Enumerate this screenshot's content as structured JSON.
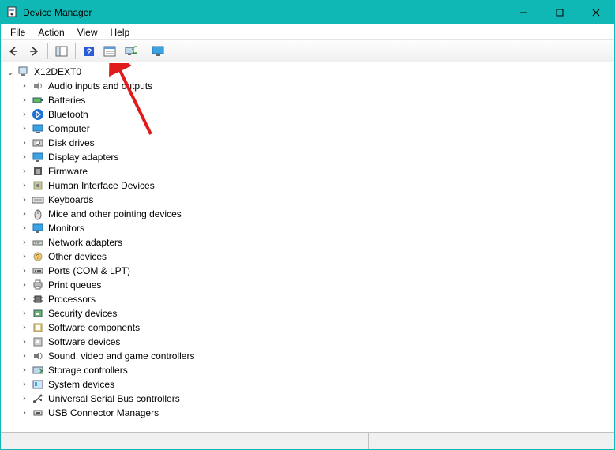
{
  "window": {
    "title": "Device Manager"
  },
  "menubar": {
    "items": [
      "File",
      "Action",
      "View",
      "Help"
    ]
  },
  "toolbar": {
    "buttons": [
      {
        "name": "back-button",
        "icon": "arrow-left-icon"
      },
      {
        "name": "forward-button",
        "icon": "arrow-right-icon"
      },
      {
        "name": "show-hide-console-button",
        "icon": "console-tree-icon"
      },
      {
        "name": "help-button",
        "icon": "help-icon"
      },
      {
        "name": "properties-button",
        "icon": "properties-icon"
      },
      {
        "name": "scan-hardware-button",
        "icon": "scan-hardware-icon"
      },
      {
        "name": "add-legacy-hardware-button",
        "icon": "monitor-icon"
      }
    ]
  },
  "tree": {
    "root": {
      "label": "X12DEXT0",
      "icon": "computer-root-icon",
      "expanded": true
    },
    "children": [
      {
        "label": "Audio inputs and outputs",
        "icon": "audio-icon"
      },
      {
        "label": "Batteries",
        "icon": "battery-icon"
      },
      {
        "label": "Bluetooth",
        "icon": "bluetooth-icon"
      },
      {
        "label": "Computer",
        "icon": "computer-icon"
      },
      {
        "label": "Disk drives",
        "icon": "disk-icon"
      },
      {
        "label": "Display adapters",
        "icon": "display-icon"
      },
      {
        "label": "Firmware",
        "icon": "firmware-icon"
      },
      {
        "label": "Human Interface Devices",
        "icon": "hid-icon"
      },
      {
        "label": "Keyboards",
        "icon": "keyboard-icon"
      },
      {
        "label": "Mice and other pointing devices",
        "icon": "mouse-icon"
      },
      {
        "label": "Monitors",
        "icon": "monitor-icon"
      },
      {
        "label": "Network adapters",
        "icon": "network-icon"
      },
      {
        "label": "Other devices",
        "icon": "other-icon"
      },
      {
        "label": "Ports (COM & LPT)",
        "icon": "ports-icon"
      },
      {
        "label": "Print queues",
        "icon": "printer-icon"
      },
      {
        "label": "Processors",
        "icon": "cpu-icon"
      },
      {
        "label": "Security devices",
        "icon": "security-icon"
      },
      {
        "label": "Software components",
        "icon": "swcomp-icon"
      },
      {
        "label": "Software devices",
        "icon": "swdev-icon"
      },
      {
        "label": "Sound, video and game controllers",
        "icon": "sound-icon"
      },
      {
        "label": "Storage controllers",
        "icon": "storage-icon"
      },
      {
        "label": "System devices",
        "icon": "system-icon"
      },
      {
        "label": "Universal Serial Bus controllers",
        "icon": "usb-icon"
      },
      {
        "label": "USB Connector Managers",
        "icon": "usb-connector-icon"
      }
    ]
  },
  "annotation": {
    "arrow_color": "#e11b1b"
  }
}
